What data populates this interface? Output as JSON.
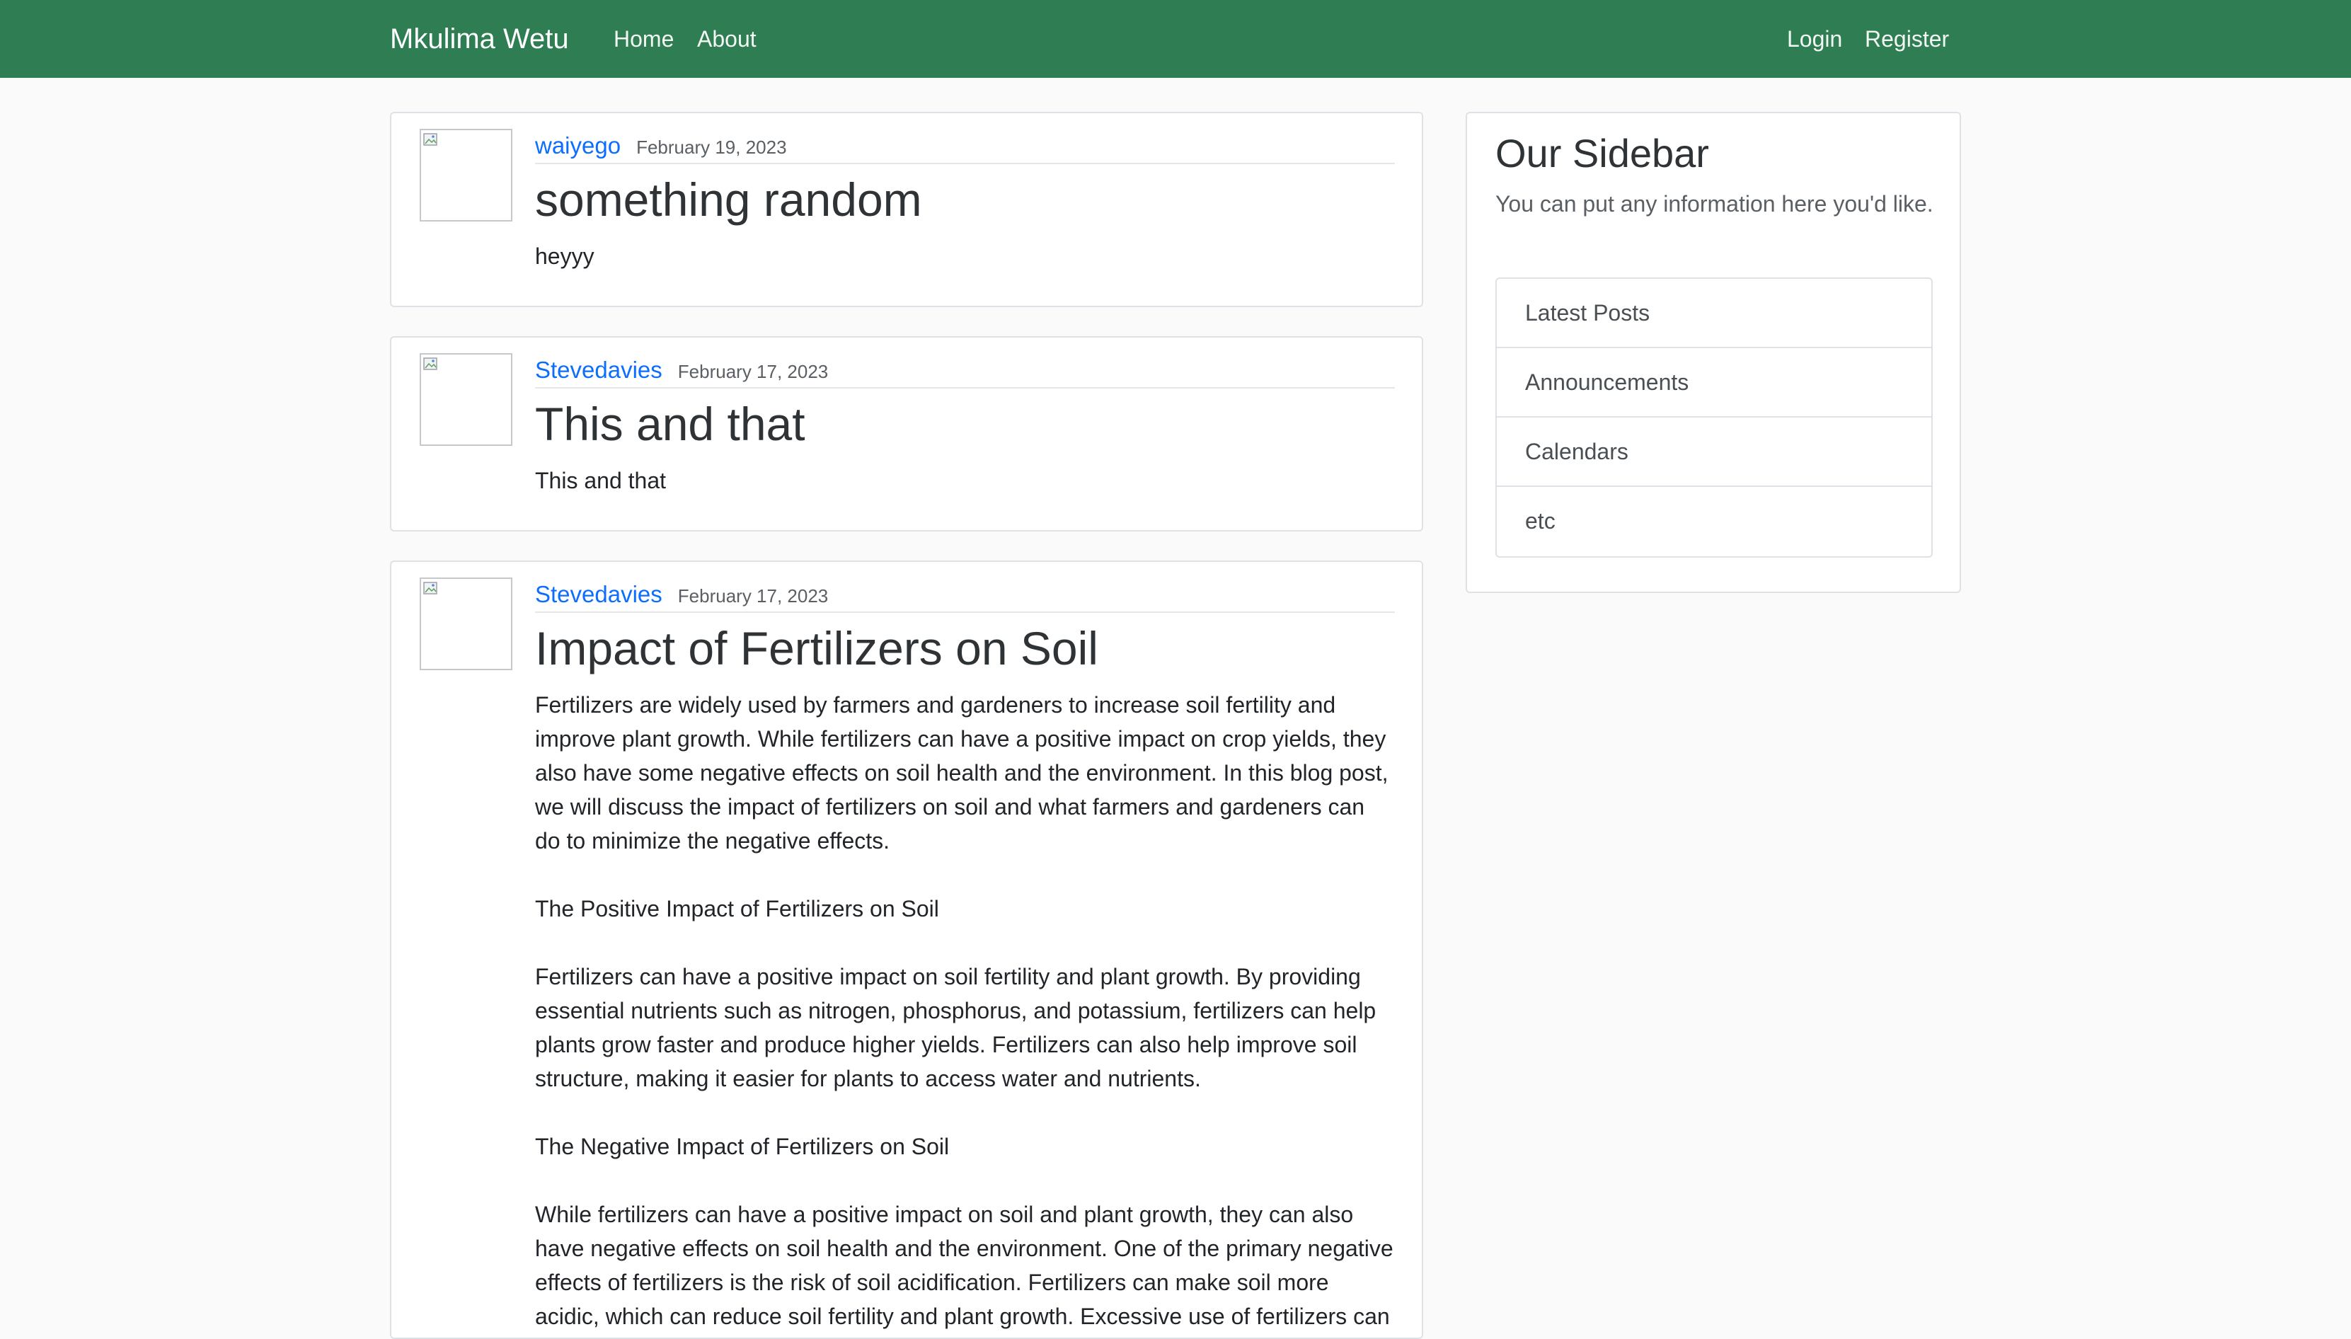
{
  "navbar": {
    "brand": "Mkulima Wetu",
    "home": "Home",
    "about": "About",
    "login": "Login",
    "register": "Register",
    "background_color": "#2e7d53"
  },
  "posts": [
    {
      "author": "waiyego",
      "date": "February 19, 2023",
      "title": "something random",
      "body": [
        "heyyy"
      ]
    },
    {
      "author": "Stevedavies",
      "date": "February 17, 2023",
      "title": "This and that",
      "body": [
        "This and that"
      ]
    },
    {
      "author": "Stevedavies",
      "date": "February 17, 2023",
      "title": "Impact of Fertilizers on Soil",
      "body": [
        "Fertilizers are widely used by farmers and gardeners to increase soil fertility and improve plant growth. While fertilizers can have a positive impact on crop yields, they also have some negative effects on soil health and the environment. In this blog post, we will discuss the impact of fertilizers on soil and what farmers and gardeners can do to minimize the negative effects.",
        "The Positive Impact of Fertilizers on Soil",
        "Fertilizers can have a positive impact on soil fertility and plant growth. By providing essential nutrients such as nitrogen, phosphorus, and potassium, fertilizers can help plants grow faster and produce higher yields. Fertilizers can also help improve soil structure, making it easier for plants to access water and nutrients.",
        "The Negative Impact of Fertilizers on Soil",
        "While fertilizers can have a positive impact on soil and plant growth, they can also have negative effects on soil health and the environment. One of the primary negative effects of fertilizers is the risk of soil acidification. Fertilizers can make soil more acidic, which can reduce soil fertility and plant growth. Excessive use of fertilizers can"
      ]
    }
  ],
  "sidebar": {
    "title": "Our Sidebar",
    "description": "You can put any information here you'd like.",
    "items": [
      "Latest Posts",
      "Announcements",
      "Calendars",
      "etc"
    ]
  },
  "colors": {
    "link": "#0d6efd",
    "border": "#dee2e6",
    "page_background": "#fafafa"
  }
}
